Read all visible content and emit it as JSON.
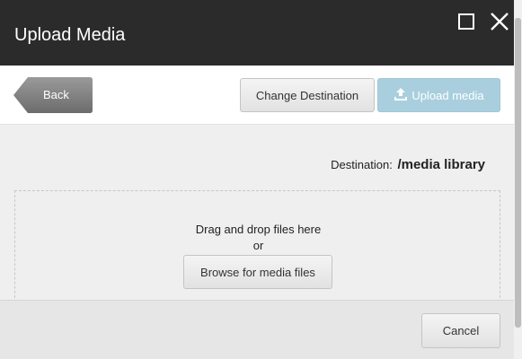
{
  "window": {
    "title": "Upload Media",
    "maximize_icon": "maximize-icon",
    "close_icon": "close-icon"
  },
  "toolbar": {
    "back_label": "Back",
    "change_destination_label": "Change Destination",
    "upload_label": "Upload media",
    "upload_icon": "upload-icon"
  },
  "destination": {
    "label": "Destination:",
    "value": "/media library"
  },
  "dropzone": {
    "text": "Drag and drop files here",
    "or": "or",
    "browse_label": "Browse for media files"
  },
  "footer": {
    "cancel_label": "Cancel"
  },
  "colors": {
    "titlebar": "#2b2b2b",
    "upload_button": "#a9cfde",
    "back_button": "#7d7d7d"
  }
}
